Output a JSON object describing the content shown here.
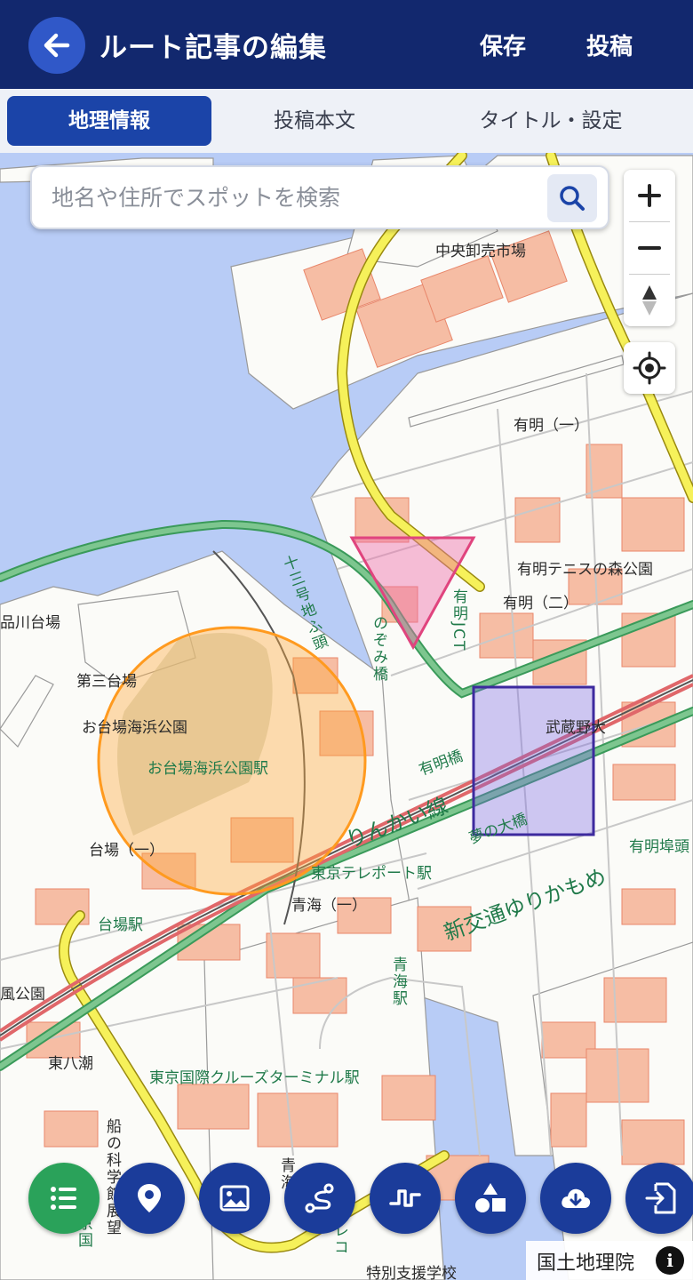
{
  "header": {
    "title": "ルート記事の編集",
    "save_label": "保存",
    "post_label": "投稿"
  },
  "tabs": [
    {
      "label": "地理情報",
      "active": true
    },
    {
      "label": "投稿本文",
      "active": false
    },
    {
      "label": "タイトル・設定",
      "active": false
    }
  ],
  "search": {
    "placeholder": "地名や住所でスポットを検索"
  },
  "map": {
    "places": {
      "chuo_oroshiuri": "中央卸売市場",
      "ariake_1": "有明（一）",
      "ariake_tennis": "有明テニスの森公園",
      "ariake_2": "有明（二）",
      "shinagawa_daiba": "品川台場",
      "daisan_daiba": "第三台場",
      "odaiba_kaihin_koen": "お台場海浜公園",
      "odaiba_kaihin_koen_eki": "お台場海浜公園駅",
      "musashino_dai": "武蔵野大",
      "daiba_1": "台場（一）",
      "tokyo_teleport": "東京テレポート駅",
      "aomi_1": "青海（一）",
      "daiba_eki": "台場駅",
      "ariake_futo": "有明埠頭",
      "kaze_koen": "風公園",
      "higashi_yashio": "東八潮",
      "cruise_terminal": "東京国際クルーズターミナル駅",
      "tokubetsu_shien": "特別支援学校",
      "yume_no_ohashi": "夢の大橋",
      "rinkai_sen": "りんかい線",
      "yurikamome": "新交通ゆりかもめ",
      "ariake_bashi": "有明橋",
      "jusangochi_futo": "十三号地ふ頭",
      "nozomi_bashi": "のぞみ橋",
      "ariake_jct": "有明JCT",
      "aomi_eki": "青海駅",
      "funenokagakukan": "船の科学館展望",
      "tokyo_koku": "東京国",
      "ao": "青海",
      "tele": "テレコ"
    },
    "shapes": {
      "circle_color": "#ff9a1f",
      "triangle_color": "#e0447e",
      "rectangle_color": "#3d2a9e"
    }
  },
  "toolbar": [
    {
      "icon": "list-icon",
      "color": "#2aa25a"
    },
    {
      "icon": "map-pin-icon",
      "color": "#1b3c9a"
    },
    {
      "icon": "image-icon",
      "color": "#1b3c9a"
    },
    {
      "icon": "route-icon",
      "color": "#1b3c9a"
    },
    {
      "icon": "elevation-profile-icon",
      "color": "#1b3c9a"
    },
    {
      "icon": "shapes-icon",
      "color": "#1b3c9a"
    },
    {
      "icon": "cloud-download-icon",
      "color": "#1b3c9a"
    },
    {
      "icon": "file-import-icon",
      "color": "#1b3c9a"
    }
  ],
  "attribution": "国土地理院"
}
